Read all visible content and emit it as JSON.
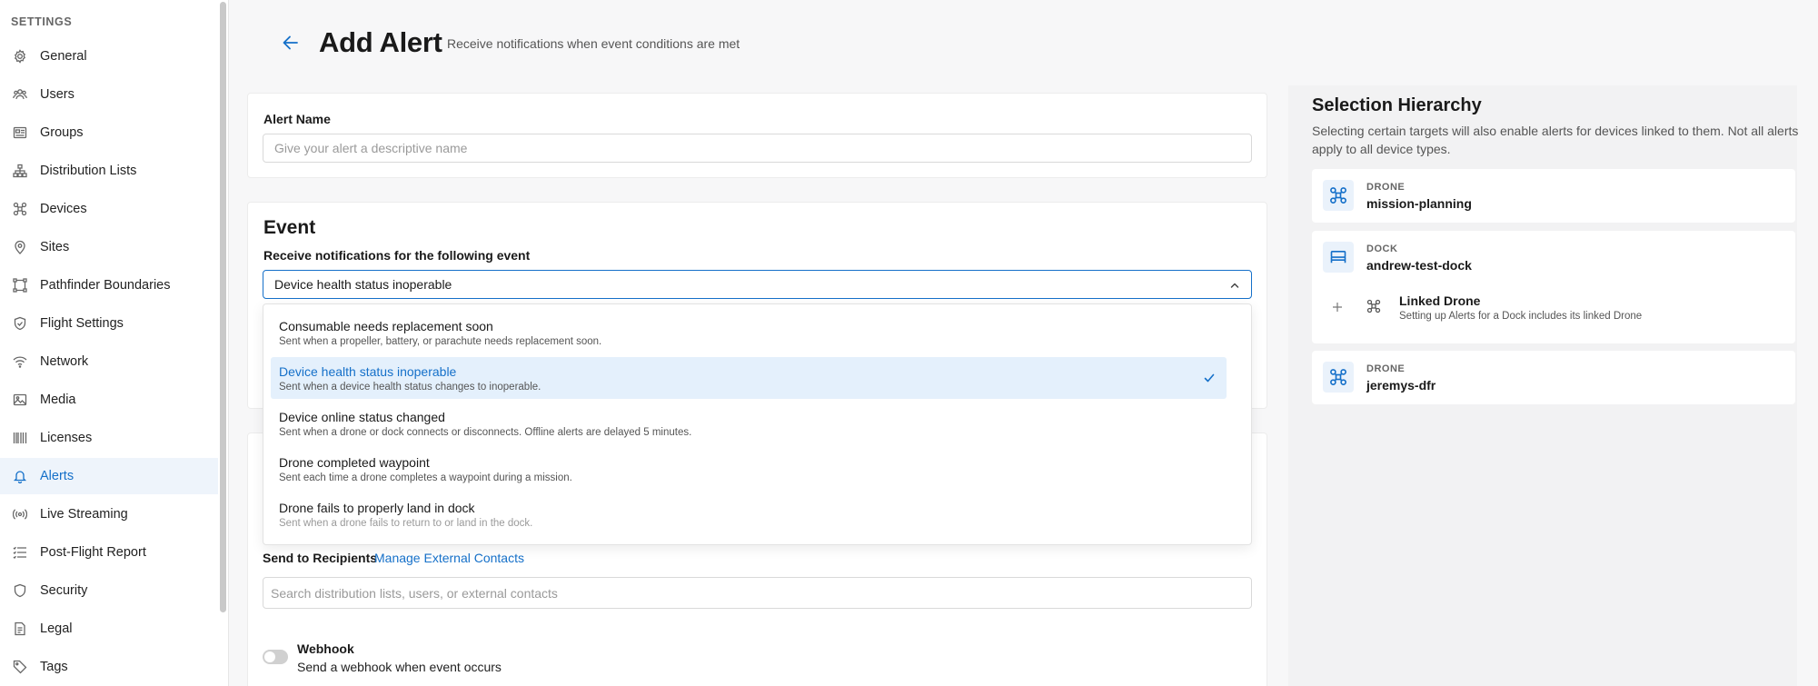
{
  "sidebar": {
    "heading": "SETTINGS",
    "items": [
      {
        "label": "General",
        "icon": "gear-icon"
      },
      {
        "label": "Users",
        "icon": "users-icon"
      },
      {
        "label": "Groups",
        "icon": "groups-icon"
      },
      {
        "label": "Distribution Lists",
        "icon": "hierarchy-icon"
      },
      {
        "label": "Devices",
        "icon": "drone-icon"
      },
      {
        "label": "Sites",
        "icon": "location-pin-icon"
      },
      {
        "label": "Pathfinder Boundaries",
        "icon": "boundary-icon"
      },
      {
        "label": "Flight Settings",
        "icon": "shield-check-icon"
      },
      {
        "label": "Network",
        "icon": "wifi-icon"
      },
      {
        "label": "Media",
        "icon": "image-icon"
      },
      {
        "label": "Licenses",
        "icon": "barcode-icon"
      },
      {
        "label": "Alerts",
        "icon": "bell-icon",
        "active": true
      },
      {
        "label": "Live Streaming",
        "icon": "broadcast-icon"
      },
      {
        "label": "Post-Flight Report",
        "icon": "list-icon"
      },
      {
        "label": "Security",
        "icon": "shield-icon"
      },
      {
        "label": "Legal",
        "icon": "document-icon"
      },
      {
        "label": "Tags",
        "icon": "tag-icon"
      }
    ]
  },
  "header": {
    "title": "Add Alert",
    "subtitle": "Receive notifications when event conditions are met"
  },
  "alert_name": {
    "label": "Alert Name",
    "placeholder": "Give your alert a descriptive name",
    "value": ""
  },
  "event": {
    "title": "Event",
    "label": "Receive notifications for the following event",
    "selected": "Device health status inoperable",
    "options": [
      {
        "title": "Consumable needs replacement soon",
        "desc": "Sent when a propeller, battery, or parachute needs replacement soon."
      },
      {
        "title": "Device health status inoperable",
        "desc": "Sent when a device health status changes to inoperable.",
        "selected": true
      },
      {
        "title": "Device online status changed",
        "desc": "Sent when a drone or dock connects or disconnects. Offline alerts are delayed 5 minutes."
      },
      {
        "title": "Drone completed waypoint",
        "desc": "Sent each time a drone completes a waypoint during a mission."
      },
      {
        "title": "Drone fails to properly land in dock",
        "desc": "Sent when a drone fails to return to or land in the dock."
      }
    ]
  },
  "recipients": {
    "label": "Send to Recipients",
    "manage_link": "Manage External Contacts",
    "placeholder": "Search distribution lists, users, or external contacts"
  },
  "webhook": {
    "title": "Webhook",
    "desc": "Send a webhook when event occurs",
    "enabled": false
  },
  "hierarchy": {
    "title": "Selection Hierarchy",
    "desc": "Selecting certain targets will also enable alerts for devices linked to them. Not all alerts apply to all device types.",
    "items": [
      {
        "type": "DRONE",
        "name": "mission-planning",
        "icon": "drone-icon"
      },
      {
        "type": "DOCK",
        "name": "andrew-test-dock",
        "icon": "dock-icon",
        "linked": {
          "title": "Linked Drone",
          "desc": "Setting up Alerts for a Dock includes its linked Drone"
        }
      },
      {
        "type": "DRONE",
        "name": "jeremys-dfr",
        "icon": "drone-icon"
      }
    ]
  },
  "colors": {
    "accent": "#1570c9",
    "selected_bg": "#e4f0fc",
    "active_nav_bg": "#eef4fb"
  }
}
